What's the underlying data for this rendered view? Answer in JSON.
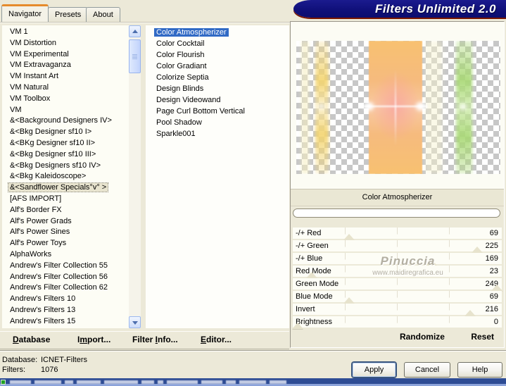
{
  "banner": {
    "text": "Filters Unlimited 2.0",
    "bg_color": "#10107a",
    "underline_color": "#7a1600"
  },
  "tabs": [
    {
      "label": "Navigator",
      "active": true
    },
    {
      "label": "Presets",
      "active": false
    },
    {
      "label": "About",
      "active": false
    }
  ],
  "category_list": {
    "selected_index": 14,
    "items": [
      "VM 1",
      "VM Distortion",
      "VM Experimental",
      "VM Extravaganza",
      "VM Instant Art",
      "VM Natural",
      "VM Toolbox",
      "VM",
      "&<Background Designers IV>",
      "&<Bkg Designer sf10 I>",
      "&<BKg Designer sf10 II>",
      "&<Bkg Designer sf10 III>",
      "&<Bkg Designers sf10 IV>",
      "&<Bkg Kaleidoscope>",
      "&<Sandflower Specials°v° >",
      "[AFS IMPORT]",
      "Alf's Border FX",
      "Alf's Power Grads",
      "Alf's Power Sines",
      "Alf's Power Toys",
      "AlphaWorks",
      "Andrew's Filter Collection 55",
      "Andrew's Filter Collection 56",
      "Andrew's Filter Collection 62",
      "Andrew's Filters 10",
      "Andrew's Filters 13",
      "Andrew's Filters 15"
    ]
  },
  "filter_list": {
    "selected_index": 0,
    "selection_color": "#316ac5",
    "items": [
      "Color Atmospherizer",
      "Color Cocktail",
      "Color Flourish",
      "Color Gradiant",
      "Colorize Septia",
      "Design Blinds",
      "Design Videowand",
      "Page Curl Bottom Vertical",
      "Pool Shadow",
      "Sparkle001"
    ]
  },
  "preview": {
    "caption": "Color Atmospherizer"
  },
  "parameters": {
    "max": 255,
    "rows": [
      {
        "name": "-/+ Red",
        "value": 69
      },
      {
        "name": "-/+ Green",
        "value": 225
      },
      {
        "name": "-/+ Blue",
        "value": 169
      },
      {
        "name": "Red Mode",
        "value": 23
      },
      {
        "name": "Green Mode",
        "value": 249
      },
      {
        "name": "Blue Mode",
        "value": 69
      },
      {
        "name": "Invert",
        "value": 216
      },
      {
        "name": "Brightness",
        "value": 0
      }
    ]
  },
  "watermark": {
    "line1": "Pinuccia",
    "line2": "www.maidiregrafica.eu"
  },
  "toolbar": {
    "buttons": [
      {
        "pre": "",
        "u": "D",
        "post": "atabase"
      },
      {
        "pre": "I",
        "u": "m",
        "post": "port..."
      },
      {
        "pre": "Filter ",
        "u": "I",
        "post": "nfo..."
      },
      {
        "pre": "",
        "u": "E",
        "post": "ditor..."
      }
    ],
    "randomize": "Randomize",
    "reset": "Reset"
  },
  "status": {
    "database_label": "Database:",
    "database_value": "ICNET-Filters",
    "filters_label": "Filters:",
    "filters_value": "1076"
  },
  "actions": {
    "apply": "Apply",
    "cancel": "Cancel",
    "help": "Help"
  }
}
